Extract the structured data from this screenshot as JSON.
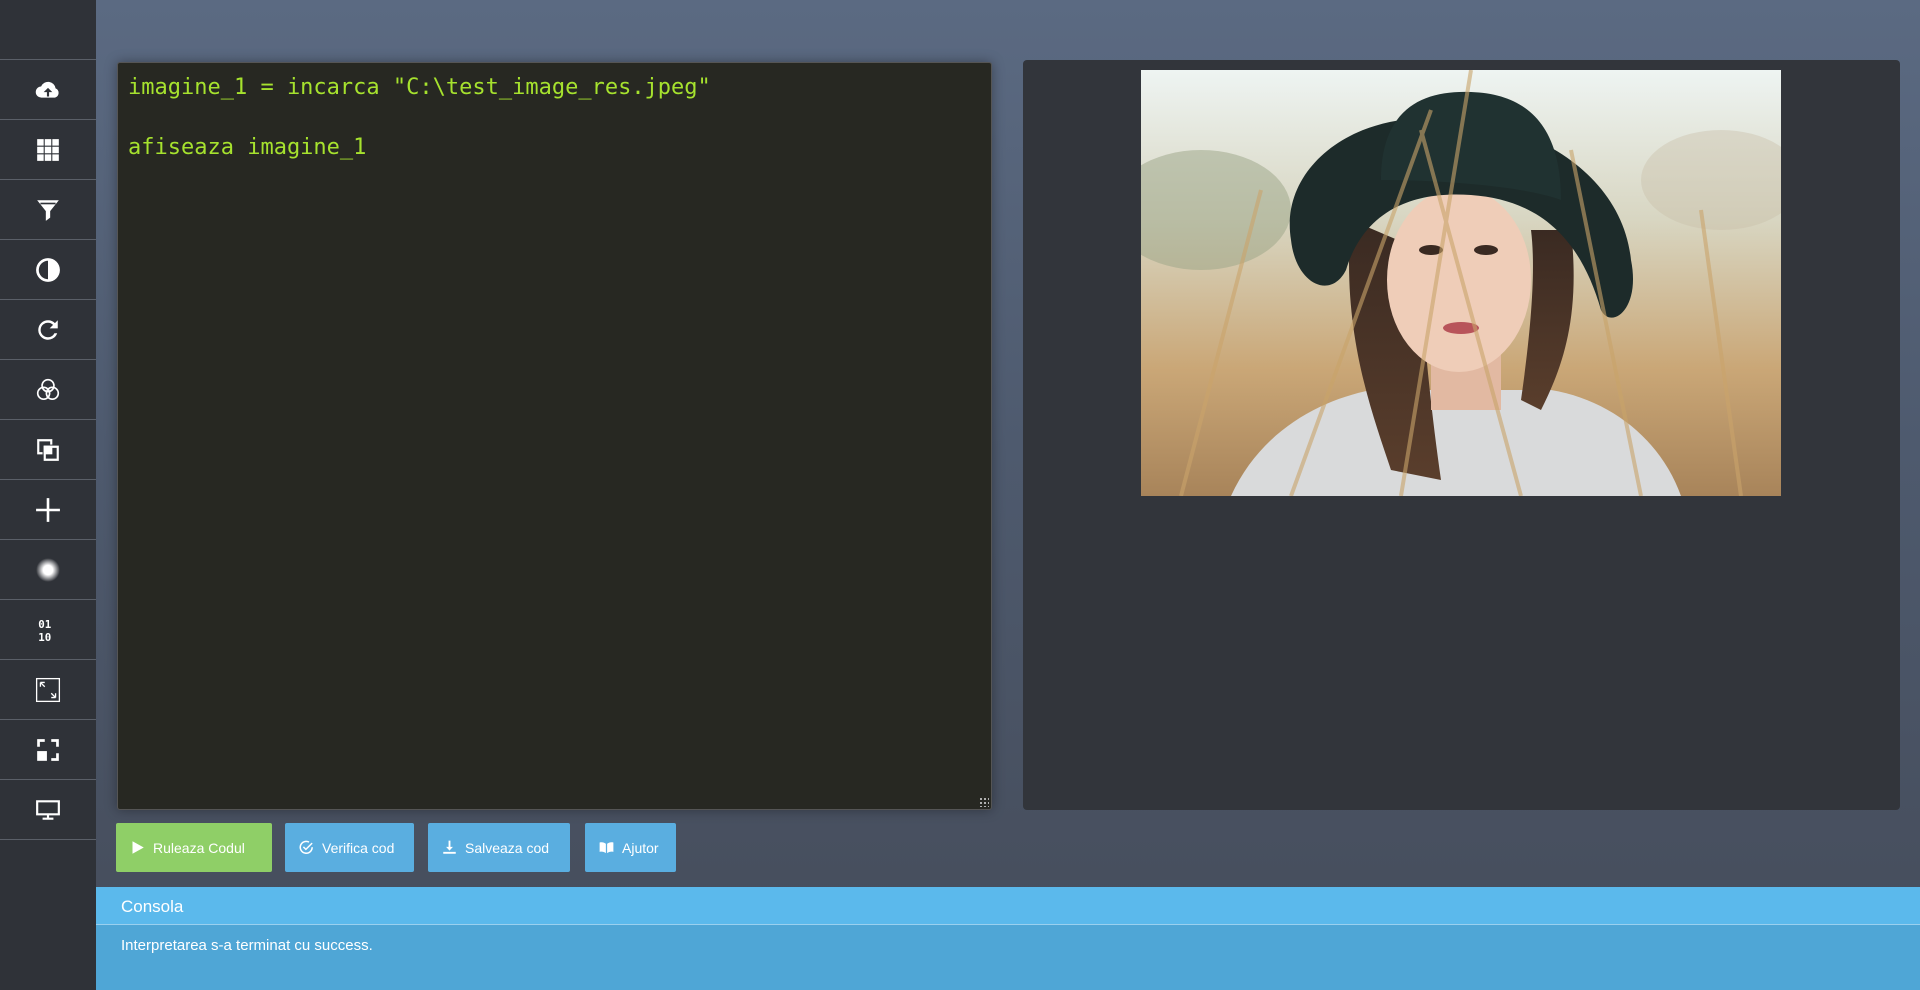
{
  "sidebar": {
    "items": [
      {
        "icon": "cloud-upload-icon",
        "name": "sidebar-item-upload"
      },
      {
        "icon": "grid-icon",
        "name": "sidebar-item-grid"
      },
      {
        "icon": "filter-icon",
        "name": "sidebar-item-filter"
      },
      {
        "icon": "contrast-icon",
        "name": "sidebar-item-contrast"
      },
      {
        "icon": "rotate-icon",
        "name": "sidebar-item-rotate"
      },
      {
        "icon": "color-channels-icon",
        "name": "sidebar-item-channels"
      },
      {
        "icon": "layers-icon",
        "name": "sidebar-item-layers"
      },
      {
        "icon": "plus-icon",
        "name": "sidebar-item-add"
      },
      {
        "icon": "blur-dot-icon",
        "name": "sidebar-item-blur"
      },
      {
        "icon": "binary-icon",
        "name": "sidebar-item-binary"
      },
      {
        "icon": "resize-image-icon",
        "name": "sidebar-item-resize"
      },
      {
        "icon": "crop-expand-icon",
        "name": "sidebar-item-crop"
      },
      {
        "icon": "monitor-icon",
        "name": "sidebar-item-display"
      }
    ]
  },
  "editor": {
    "lines": [
      "imagine_1 = incarca \"C:\\test_image_res.jpeg\"",
      "",
      "afiseaza imagine_1"
    ],
    "text_color": "#a6e22e",
    "background": "#272822"
  },
  "preview": {
    "image": "photo of a woman with a dark hat in tall grass"
  },
  "toolbar": {
    "run_label": "Ruleaza Codul",
    "verify_label": "Verifica cod",
    "save_label": "Salveaza cod",
    "help_label": "Ajutor"
  },
  "console": {
    "title": "Consola",
    "message": "Interpretarea s-a terminat cu success."
  },
  "colors": {
    "run_button": "#8fcf67",
    "action_button": "#5aaee0",
    "console_header": "#5bb9ec",
    "console_body": "#4fa6d6"
  }
}
